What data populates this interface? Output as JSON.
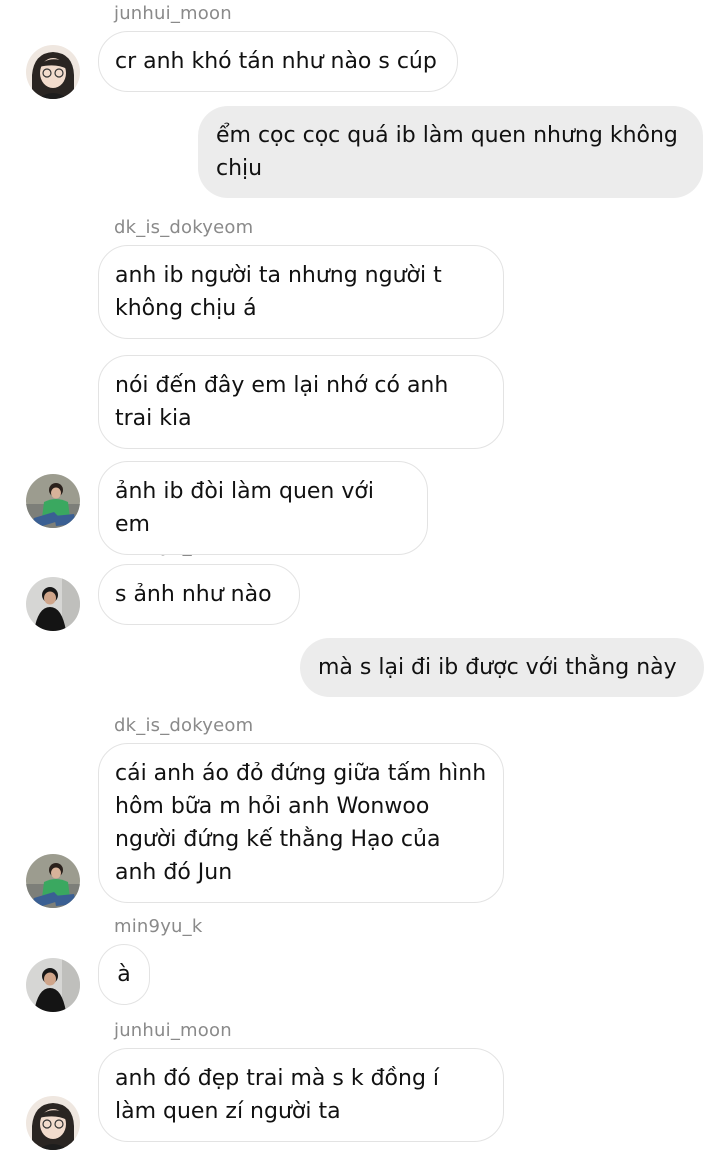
{
  "chat": {
    "sender_names": {
      "n1": "junhui_moon",
      "n2": "dk_is_dokyeom",
      "n3": "min9yu_k",
      "n4": "dk_is_dokyeom",
      "n5": "min9yu_k",
      "n6": "junhui_moon"
    },
    "messages": [
      {
        "sender": "junhui_moon",
        "direction": "incoming",
        "text": "cr anh khó tán như nào s cúp"
      },
      {
        "sender": "me",
        "direction": "outgoing",
        "text": "ểm cọc cọc quá ib làm quen nhưng không chịu"
      },
      {
        "sender": "dk_is_dokyeom",
        "direction": "incoming",
        "text": "anh ib người ta nhưng người t không chịu á"
      },
      {
        "sender": "dk_is_dokyeom",
        "direction": "incoming",
        "text": "nói đến đây em lại nhớ có anh trai kia"
      },
      {
        "sender": "dk_is_dokyeom",
        "direction": "incoming",
        "text": "ảnh ib đòi làm quen với em"
      },
      {
        "sender": "min9yu_k",
        "direction": "incoming",
        "text": "s ảnh như nào"
      },
      {
        "sender": "me",
        "direction": "outgoing",
        "text": "mà s lại đi ib được với thằng này"
      },
      {
        "sender": "dk_is_dokyeom",
        "direction": "incoming",
        "text": "cái anh áo đỏ đứng giữa tấm hình hôm bữa m hỏi anh Wonwoo người đứng kế thằng Hạo của anh đó Jun"
      },
      {
        "sender": "min9yu_k",
        "direction": "incoming",
        "text": "à"
      },
      {
        "sender": "junhui_moon",
        "direction": "incoming",
        "text": "anh đó đẹp trai mà s k đồng í làm quen zí người ta"
      }
    ]
  },
  "colors": {
    "incoming_bubble": "#ffffff",
    "incoming_border": "#e3e3e3",
    "outgoing_bubble": "#ececec",
    "username": "#8a8a8a",
    "text": "#111111"
  },
  "avatars": {
    "junhui_moon": "junhui-avatar",
    "dk_is_dokyeom": "dokyeom-avatar",
    "min9yu_k": "mingyu-avatar"
  }
}
